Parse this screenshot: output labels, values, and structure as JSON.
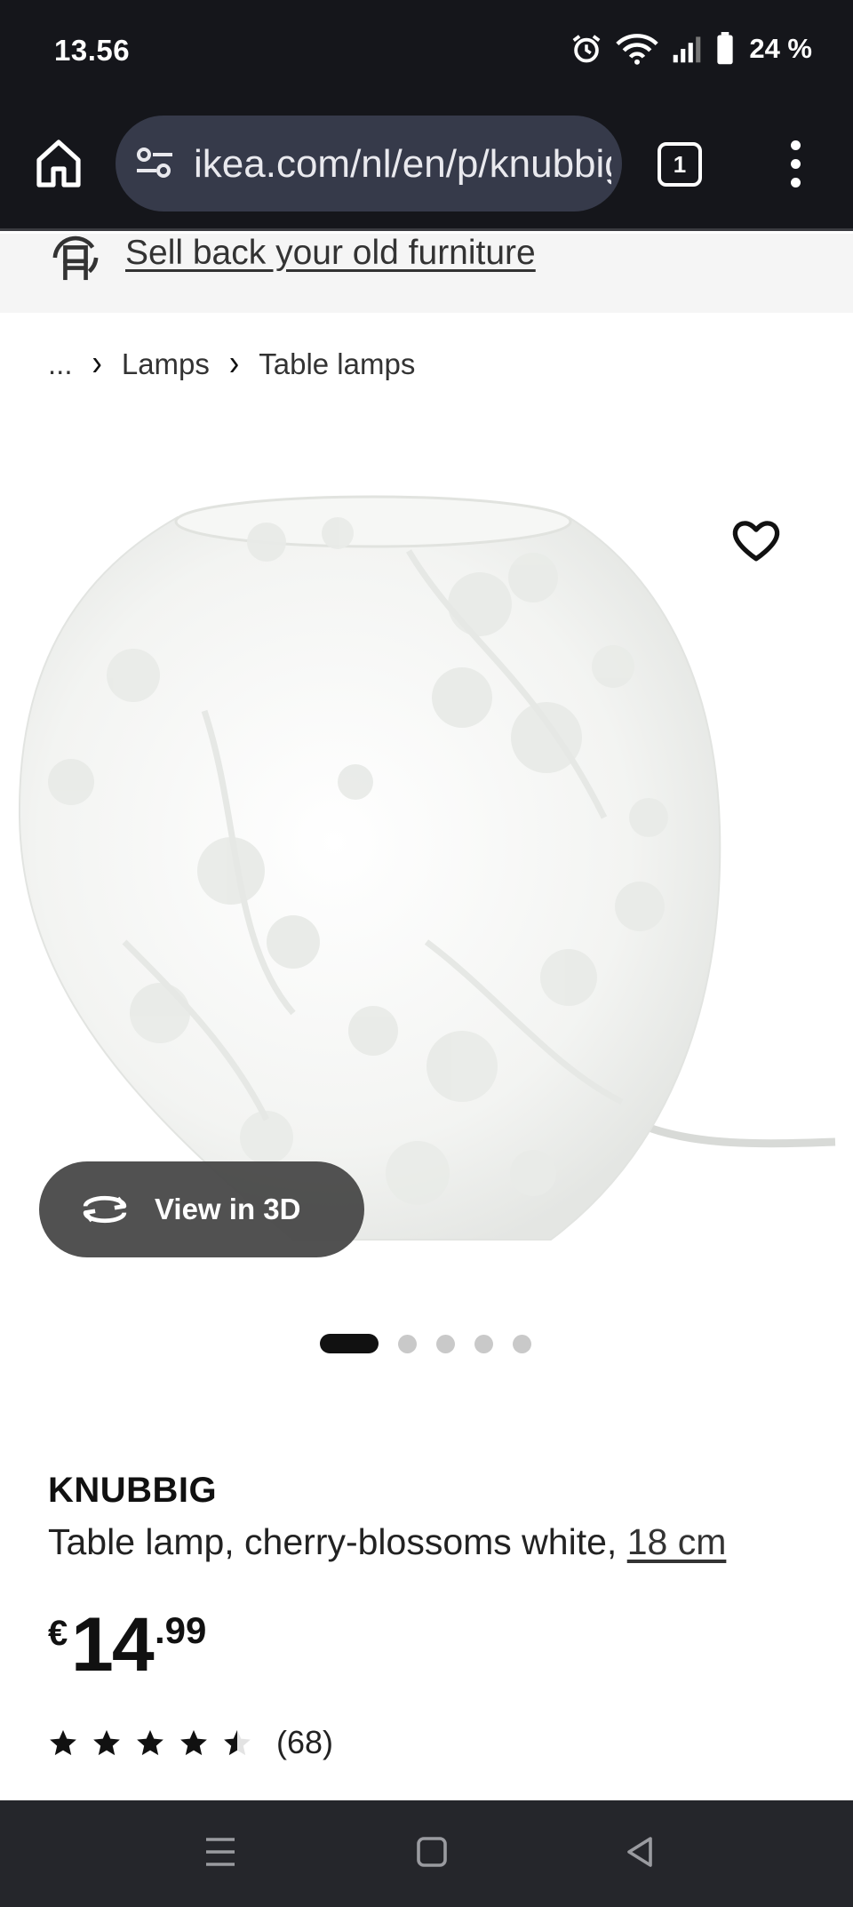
{
  "status_bar": {
    "time": "13.56",
    "battery": "24 %"
  },
  "browser": {
    "url": "ikea.com/nl/en/p/knubbig",
    "tab_count": "1"
  },
  "banner": {
    "sell_back_label": "Sell back your old furniture"
  },
  "breadcrumb": {
    "ellipsis": "...",
    "items": [
      "Lamps",
      "Table lamps"
    ]
  },
  "gallery": {
    "view_3d_label": "View in 3D",
    "image_count": 5,
    "active_index": 0
  },
  "product": {
    "name": "KNUBBIG",
    "description": "Table lamp, cherry-blossoms white,",
    "size": "18 cm",
    "price": {
      "currency": "€",
      "integer": "14",
      "decimal": ".99"
    },
    "rating": {
      "value": 4.5,
      "max": 5,
      "count_label": "(68)"
    }
  },
  "colors": {
    "dark_bar": "#15161b",
    "url_bar": "#363a4a",
    "nav_bar": "#25262b",
    "accent_black": "#111111"
  },
  "icons": [
    "home-icon",
    "site-settings-icon",
    "tabs-icon",
    "more-vert-icon",
    "sell-back-icon",
    "heart-icon",
    "rotate-3d-icon",
    "star-icon",
    "recents-icon",
    "home-nav-icon",
    "back-nav-icon"
  ]
}
